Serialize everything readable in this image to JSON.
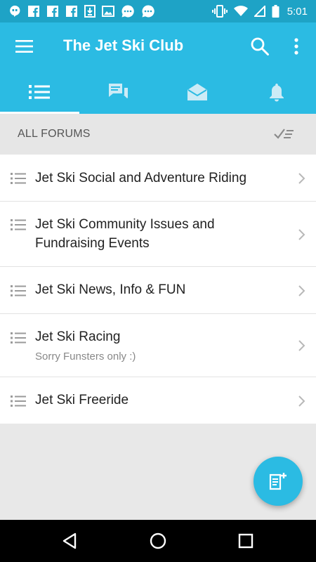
{
  "status_bar": {
    "time": "5:01",
    "left_icons": [
      "hangouts-icon",
      "facebook-icon",
      "facebook-icon",
      "facebook-icon",
      "download-icon",
      "image-icon",
      "chat-bubble-icon",
      "chat-bubble-icon"
    ],
    "right_icons": [
      "vibrate-icon",
      "wifi-icon",
      "signal-icon",
      "battery-icon"
    ]
  },
  "app_bar": {
    "title": "The Jet Ski Club",
    "color": "#2bbbe3"
  },
  "tabs": [
    {
      "icon": "list-icon",
      "active": true
    },
    {
      "icon": "conversations-icon",
      "active": false
    },
    {
      "icon": "inbox-icon",
      "active": false
    },
    {
      "icon": "notifications-icon",
      "active": false
    }
  ],
  "section": {
    "title": "ALL FORUMS"
  },
  "forums": [
    {
      "title_lines": [
        "Jet Ski Social and Adventure Riding"
      ],
      "subtitle": ""
    },
    {
      "title_lines": [
        "Jet Ski Community Issues and",
        "Fundraising Events"
      ],
      "subtitle": ""
    },
    {
      "title_lines": [
        "Jet Ski News, Info & FUN"
      ],
      "subtitle": ""
    },
    {
      "title_lines": [
        "Jet Ski Racing"
      ],
      "subtitle": "Sorry Funsters only :)"
    },
    {
      "title_lines": [
        "Jet Ski Freeride"
      ],
      "subtitle": ""
    }
  ],
  "fab": {
    "icon": "new-post-icon"
  },
  "nav": [
    "back-icon",
    "home-icon",
    "recents-icon"
  ]
}
